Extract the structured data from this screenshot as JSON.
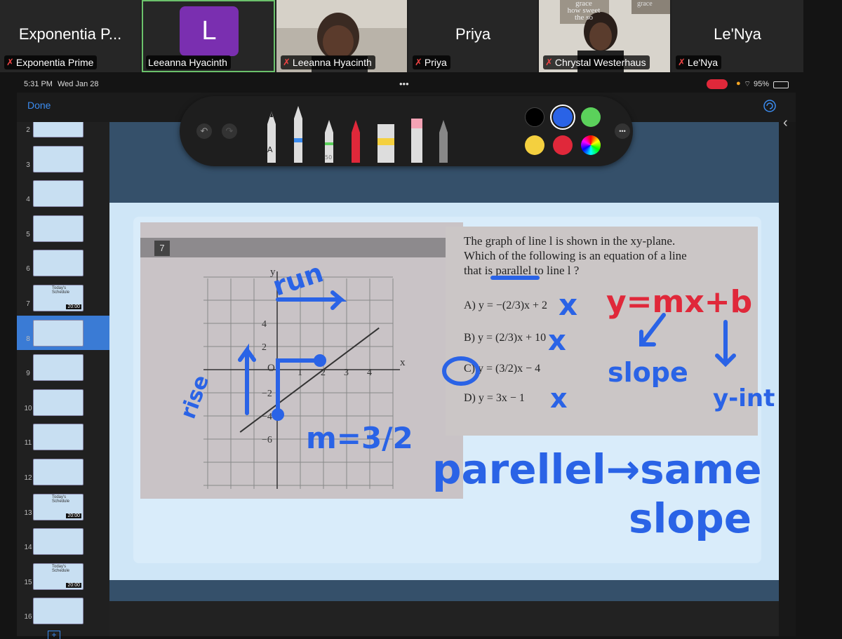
{
  "participants": [
    {
      "display": "Exponentia P...",
      "caption": "Exponentia Prime"
    },
    {
      "display": "L",
      "caption": "Leeanna Hyacinth"
    },
    {
      "display": "",
      "caption": "Leeanna Hyacinth"
    },
    {
      "display": "Priya",
      "caption": "Priya"
    },
    {
      "display": "",
      "caption": "Chrystal Westerhaus"
    },
    {
      "display": "Le'Nya",
      "caption": "Le'Nya"
    }
  ],
  "webcam_sign": {
    "lines": [
      "grace",
      "how sweet",
      "the so"
    ],
    "corner": "grace"
  },
  "status": {
    "time": "5:31 PM",
    "date": "Wed Jan 28",
    "dots": "•••",
    "battery": "95%"
  },
  "topbar": {
    "done": "Done"
  },
  "toolbar": {
    "pen_label": "A",
    "marker_size": "50",
    "more": "•••"
  },
  "thumbnails": [
    "2",
    "3",
    "4",
    "5",
    "6",
    "7",
    "8",
    "9",
    "10",
    "11",
    "12",
    "13",
    "14",
    "15",
    "16"
  ],
  "thumb_labels": {
    "schedule": "Today's Schedule",
    "timer": "20:00"
  },
  "book": {
    "problem_number": "7",
    "question_lines": [
      "The graph of line l is shown in the xy-plane.",
      "Which of the following is an equation of a line",
      "that is parallel to line l ?"
    ],
    "choices": [
      "A)  y = −(2/3)x + 2",
      "B)  y = (2/3)x + 10",
      "C)  y = (3/2)x − 4",
      "D)  y = 3x − 1"
    ],
    "axis_labels": {
      "x": "x",
      "y": "y",
      "origin": "O"
    },
    "xticks": [
      "1",
      "2",
      "3",
      "4"
    ],
    "yticks": [
      "4",
      "2",
      "−2",
      "−4",
      "−6"
    ]
  },
  "handwriting": {
    "run": "run",
    "rise": "rise",
    "slope_eq": "m=3/2",
    "formula": "y=mx+b",
    "slope": "slope",
    "yint": "y-int",
    "parallel": "parellel→same",
    "slope2": "slope",
    "marks": [
      "x",
      "x",
      "x"
    ]
  },
  "colors": {
    "ink_blue": "#2a63e6",
    "ink_red": "#e0283a",
    "active_border": "#6bc16b"
  },
  "plus": "+"
}
